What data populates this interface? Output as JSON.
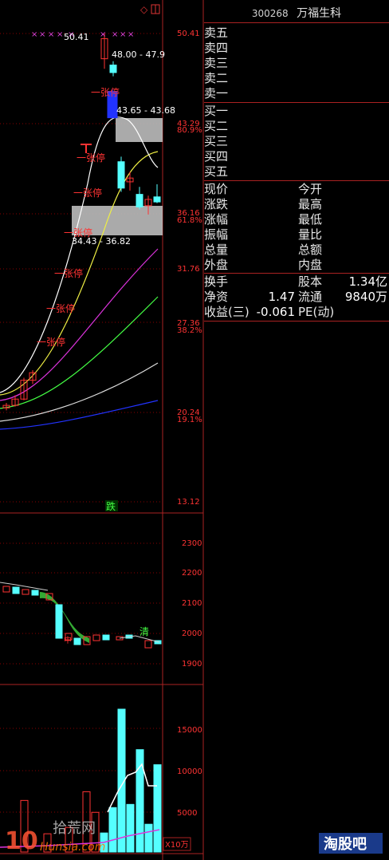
{
  "stock": {
    "code": "300268",
    "name": "万福生科"
  },
  "order_book": {
    "sell": [
      "卖五",
      "卖四",
      "卖三",
      "卖二",
      "卖一"
    ],
    "buy": [
      "买一",
      "买二",
      "买三",
      "买四",
      "买五"
    ]
  },
  "quote": {
    "row1": [
      {
        "label": "现价",
        "value": ""
      },
      {
        "label": "今开",
        "value": ""
      }
    ],
    "row2": [
      {
        "label": "涨跌",
        "value": ""
      },
      {
        "label": "最高",
        "value": ""
      }
    ],
    "row3": [
      {
        "label": "涨幅",
        "value": ""
      },
      {
        "label": "最低",
        "value": ""
      }
    ],
    "row4": [
      {
        "label": "振幅",
        "value": ""
      },
      {
        "label": "量比",
        "value": ""
      }
    ],
    "row5": [
      {
        "label": "总量",
        "value": ""
      },
      {
        "label": "总额",
        "value": ""
      }
    ],
    "row6": [
      {
        "label": "外盘",
        "value": ""
      },
      {
        "label": "内盘",
        "value": ""
      }
    ]
  },
  "fundamentals": [
    {
      "label": "换手",
      "value": "",
      "label2": "股本",
      "value2": "1.34亿"
    },
    {
      "label": "净资",
      "value": "1.47",
      "label2": "流通",
      "value2": "9840万"
    },
    {
      "label": "收益(三)",
      "value": "-0.061",
      "label2": "PE(动)",
      "value2": ""
    }
  ],
  "price_axis": [
    "50.41",
    "43.29",
    "80.9%",
    "36.16",
    "61.8%",
    "31.76",
    "27.36",
    "38.2%",
    "20.24",
    "19.1%",
    "13.12"
  ],
  "chart_labels": {
    "high_mark": "50.41",
    "high_range": "48.00 - 47.9",
    "mid_range": "43.65 - 43.68",
    "low_range": "34.43 - 36.82",
    "fall_tag": "跌",
    "clear_tag": "清",
    "limit_up": "一张停",
    "mid_tag": "中"
  },
  "indicator_axis": [
    "2300",
    "2200",
    "2100",
    "2000",
    "1900"
  ],
  "volume_axis": [
    "15000",
    "10000",
    "5000"
  ],
  "volume_unit": "X10万",
  "watermark_left": "10 拾荒网 Hunsia.com",
  "watermark_right": "淘股吧",
  "colors": {
    "up": "#ff3333",
    "down": "#55ffff",
    "axis": "#aa2222",
    "grid": "#880000",
    "label": "#ff3333"
  },
  "chart_data": [
    {
      "type": "candlestick",
      "title": "",
      "y_ticks": [
        50.41,
        43.29,
        36.16,
        31.76,
        27.36,
        20.24,
        13.12
      ],
      "ylim": [
        13.12,
        50.41
      ],
      "candles": [
        {
          "o": 20.6,
          "h": 21.0,
          "l": 20.4,
          "c": 20.8
        },
        {
          "o": 20.8,
          "h": 21.6,
          "l": 20.7,
          "c": 21.3
        },
        {
          "o": 21.3,
          "h": 23.0,
          "l": 21.2,
          "c": 22.8
        },
        {
          "o": 22.8,
          "h": 23.6,
          "l": 22.5,
          "c": 23.4
        },
        {
          "o": 48.4,
          "h": 50.41,
          "l": 47.6,
          "c": 50.0
        },
        {
          "o": 47.9,
          "h": 48.2,
          "l": 47.0,
          "c": 47.3
        },
        {
          "o": 45.8,
          "h": 46.0,
          "l": 43.65,
          "c": 43.7
        },
        {
          "o": 40.2,
          "h": 40.6,
          "l": 37.8,
          "c": 38.1
        },
        {
          "o": 38.6,
          "h": 39.4,
          "l": 37.9,
          "c": 38.9
        },
        {
          "o": 37.6,
          "h": 38.2,
          "l": 36.4,
          "c": 36.6
        },
        {
          "o": 36.7,
          "h": 37.5,
          "l": 36.0,
          "c": 37.2
        },
        {
          "o": 37.4,
          "h": 38.4,
          "l": 36.9,
          "c": 37.0
        }
      ]
    },
    {
      "type": "line",
      "title": "",
      "y_ticks": [
        2300,
        2200,
        2100,
        2000,
        1900
      ],
      "ylim": [
        1880,
        2340
      ]
    },
    {
      "type": "bar",
      "title": "",
      "y_ticks": [
        15000,
        10000,
        5000
      ],
      "ylim": [
        0,
        19000
      ],
      "values": [
        7600,
        2400,
        5600,
        18000,
        6000,
        12900,
        3500,
        11000,
        5000,
        3100,
        2300,
        6500
      ],
      "ma": [
        null,
        null,
        null,
        7600,
        8100,
        9600,
        9000,
        11000,
        10800,
        8600,
        8300,
        8300
      ]
    }
  ]
}
